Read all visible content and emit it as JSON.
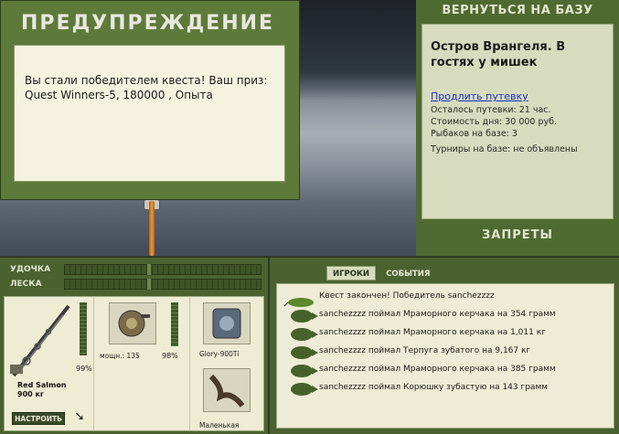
{
  "warning": {
    "title": "ПРЕДУПРЕЖДЕНИЕ",
    "message_line1": "Вы стали победителем квеста! Ваш приз:",
    "message_line2": "Quest Winners-5, 180000 , Опыта"
  },
  "base": {
    "back_label": "ВЕРНУТЬСЯ НА БАЗУ",
    "location": "Остров Врангеля. В гостях у мишек",
    "extend_link": "Продлить путевку",
    "remaining": "Осталось путевки: 21 час.",
    "day_cost": "Стоимость дня: 30 000 руб.",
    "fishers": "Рыбаков на базе: 3",
    "tournaments": "Турниры на базе: не объявлены",
    "bans_label": "ЗАПРЕТЫ"
  },
  "tackle": {
    "rod_label": "УДОЧКА",
    "line_label": "ЛЕСКА",
    "rod_name": "Red Salmon",
    "rod_weight": "900 кг",
    "rod_durability": "99%",
    "reel_power": "мощн.: 135",
    "reel_durability": "98%",
    "line_name": "Glory-900Ti",
    "lure_name": "Маленькая",
    "setup_label": "НАСТРОИТЬ"
  },
  "log": {
    "tabs": [
      "ИГРОКИ",
      "СОБЫТИЯ"
    ],
    "entries": [
      "Квест закончен! Победитель sanchezzzz",
      "sanchezzzz поймал Мраморного керчака на 354 грамм",
      "sanchezzzz поймал Мраморного керчака на 1,011 кг",
      "sanchezzzz поймал Терпуга зубатого на 9,167 кг",
      "sanchezzzz поймал Мраморного керчака на 385 грамм",
      "sanchezzzz поймал Корюшку зубастую на 143 грамм"
    ]
  }
}
